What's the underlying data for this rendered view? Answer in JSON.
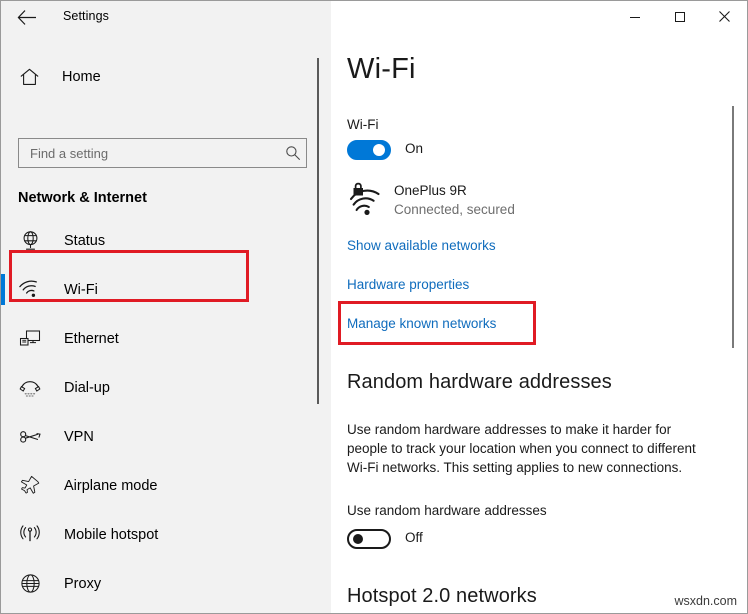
{
  "window": {
    "title": "Settings",
    "back_icon": "back-arrow-icon",
    "minimize_label": "–",
    "maximize_label": "□",
    "close_label": "✕"
  },
  "sidebar": {
    "home": {
      "label": "Home",
      "icon": "home-icon"
    },
    "search": {
      "value": "",
      "placeholder": "Find a setting",
      "icon": "search-icon"
    },
    "category": "Network & Internet",
    "items": [
      {
        "label": "Status",
        "icon": "status-globe-icon",
        "selected": false
      },
      {
        "label": "Wi-Fi",
        "icon": "wifi-icon",
        "selected": true
      },
      {
        "label": "Ethernet",
        "icon": "ethernet-icon",
        "selected": false
      },
      {
        "label": "Dial-up",
        "icon": "dialup-phone-icon",
        "selected": false
      },
      {
        "label": "VPN",
        "icon": "vpn-key-icon",
        "selected": false
      },
      {
        "label": "Airplane mode",
        "icon": "airplane-icon",
        "selected": false
      },
      {
        "label": "Mobile hotspot",
        "icon": "mobile-hotspot-icon",
        "selected": false
      },
      {
        "label": "Proxy",
        "icon": "proxy-globe-icon",
        "selected": false
      }
    ]
  },
  "main": {
    "page_title": "Wi-Fi",
    "wifi_section": {
      "label": "Wi-Fi",
      "toggle_state": "On",
      "toggle_on": true
    },
    "connected_network": {
      "name": "OnePlus 9R",
      "status": "Connected, secured",
      "icon": "wifi-secured-icon"
    },
    "links": [
      {
        "label": "Show available networks"
      },
      {
        "label": "Hardware properties"
      },
      {
        "label": "Manage known networks",
        "highlighted": true
      }
    ],
    "random_hw": {
      "heading": "Random hardware addresses",
      "description": "Use random hardware addresses to make it harder for people to track your location when you connect to different Wi-Fi networks. This setting applies to new connections.",
      "toggle_label": "Use random hardware addresses",
      "toggle_state": "Off",
      "toggle_on": false
    },
    "hotspot_heading": "Hotspot 2.0 networks"
  },
  "annotations": {
    "highlight_color": "#e01b24",
    "boxes": [
      {
        "target": "sidebar-item-wi-fi"
      },
      {
        "target": "link-manage-known-networks"
      }
    ]
  },
  "watermark": "wsxdn.com",
  "colors": {
    "accent": "#0078d7",
    "link": "#0f6cbd",
    "sidebar_bg": "#f2f2f2",
    "content_bg": "#ffffff"
  }
}
